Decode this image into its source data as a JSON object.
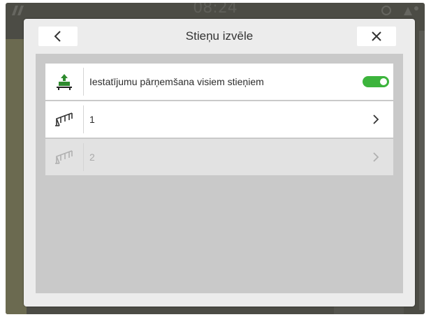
{
  "status_bar": {
    "clock": "08:24"
  },
  "dialog": {
    "title": "Stieņu izvēle",
    "back_icon": "chevron-left-icon",
    "close_icon": "close-icon"
  },
  "rows": [
    {
      "label": "Iestatījumu pārņemšana visiem stieņiem",
      "icon": "transfer-settings-icon",
      "control": "toggle",
      "toggle_on": true
    },
    {
      "label": "1",
      "icon": "boom-section-icon",
      "control": "chevron-right-icon",
      "enabled": true
    },
    {
      "label": "2",
      "icon": "boom-section-icon",
      "control": "chevron-right-icon",
      "enabled": false
    }
  ],
  "colors": {
    "toggle_on": "#3cb43c",
    "dialog_bg": "#ececec",
    "content_bg": "#c9c9c9",
    "icon_green": "#2e8b2e"
  }
}
